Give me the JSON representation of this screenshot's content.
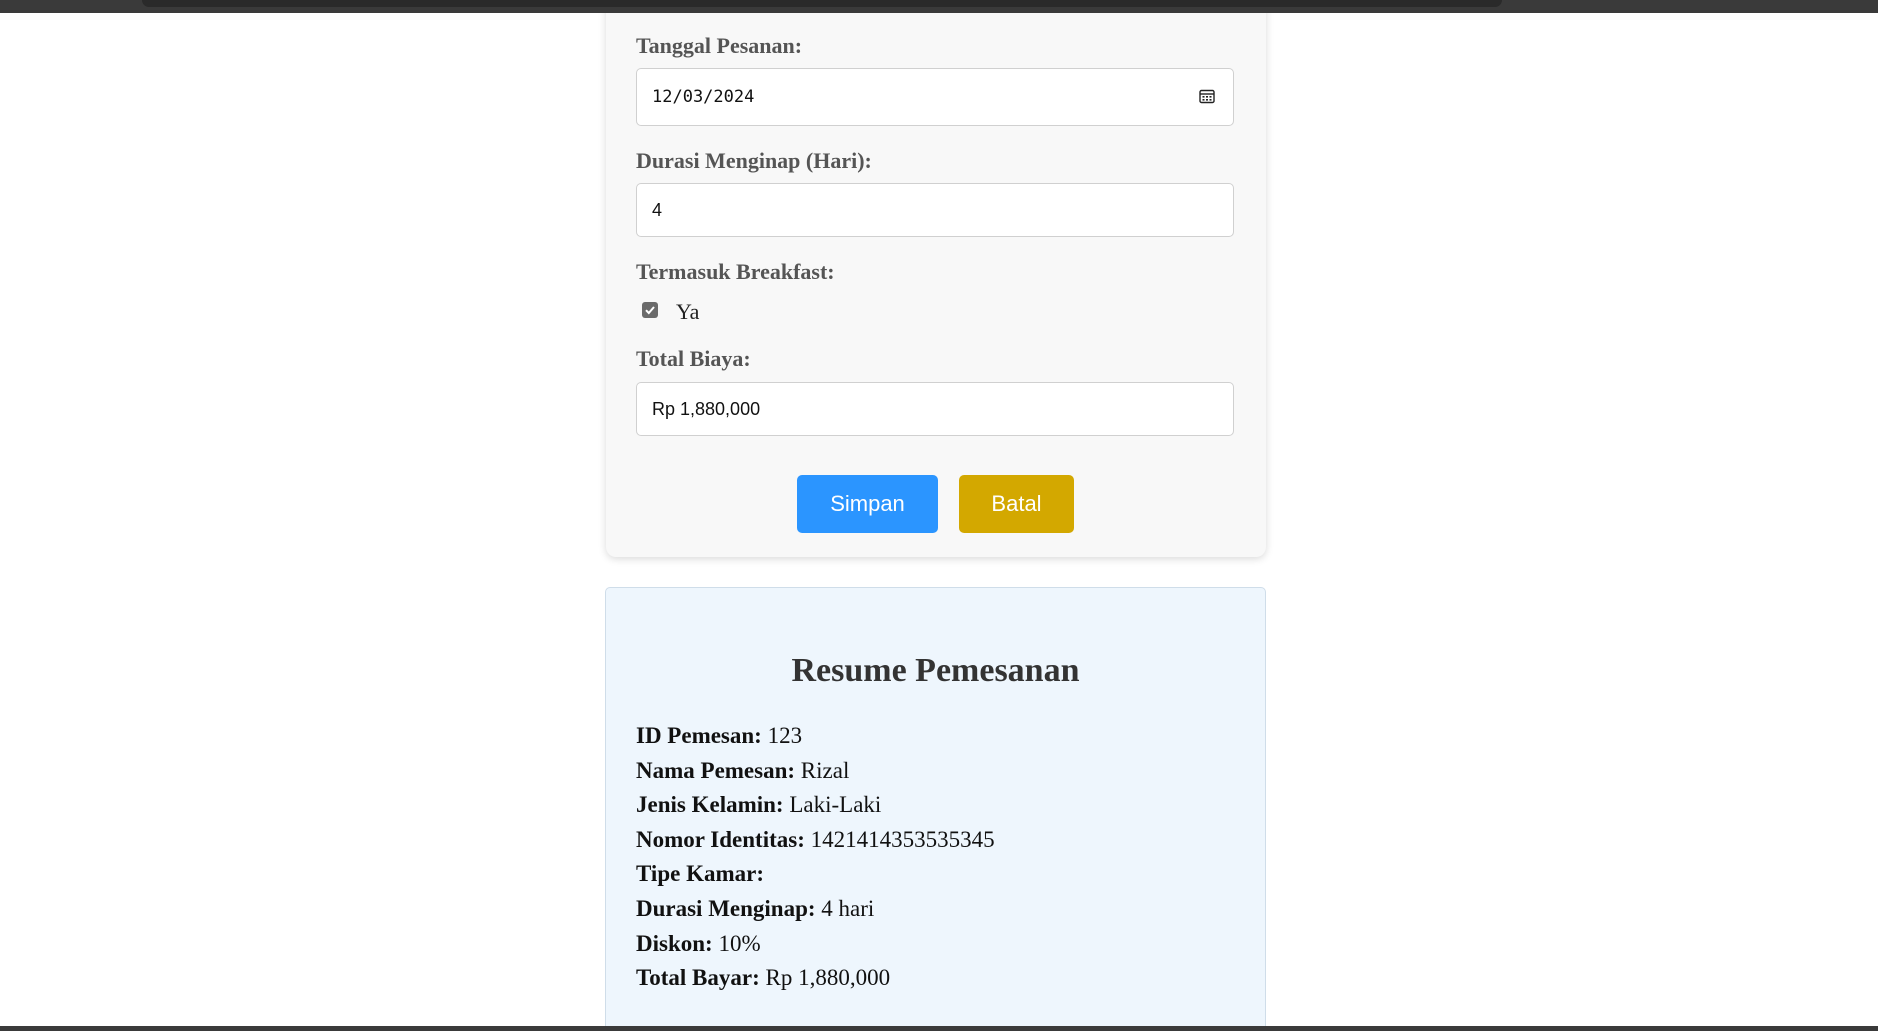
{
  "colors": {
    "primary_button": "#2b95ff",
    "warning_button": "#d3a800",
    "form_background": "#f8f8f8",
    "resume_background": "#eef6fd"
  },
  "form": {
    "order_date": {
      "label": "Tanggal Pesanan:",
      "value": "12/03/2024",
      "icon": "calendar-icon"
    },
    "duration": {
      "label": "Durasi Menginap (Hari):",
      "value": "4"
    },
    "breakfast": {
      "label": "Termasuk Breakfast:",
      "option_label": "Ya",
      "checked": true
    },
    "total_cost": {
      "label": "Total Biaya:",
      "value": "Rp 1,880,000"
    },
    "buttons": {
      "save_label": "Simpan",
      "cancel_label": "Batal"
    }
  },
  "resume": {
    "title": "Resume Pemesanan",
    "lines": [
      {
        "label": "ID Pemesan:",
        "value": "123"
      },
      {
        "label": "Nama Pemesan:",
        "value": "Rizal"
      },
      {
        "label": "Jenis Kelamin:",
        "value": "Laki-Laki"
      },
      {
        "label": "Nomor Identitas:",
        "value": "1421414353535345"
      },
      {
        "label": "Tipe Kamar:",
        "value": ""
      },
      {
        "label": "Durasi Menginap:",
        "value": "4 hari"
      },
      {
        "label": "Diskon:",
        "value": "10%"
      },
      {
        "label": "Total Bayar:",
        "value": "Rp 1,880,000"
      }
    ]
  }
}
